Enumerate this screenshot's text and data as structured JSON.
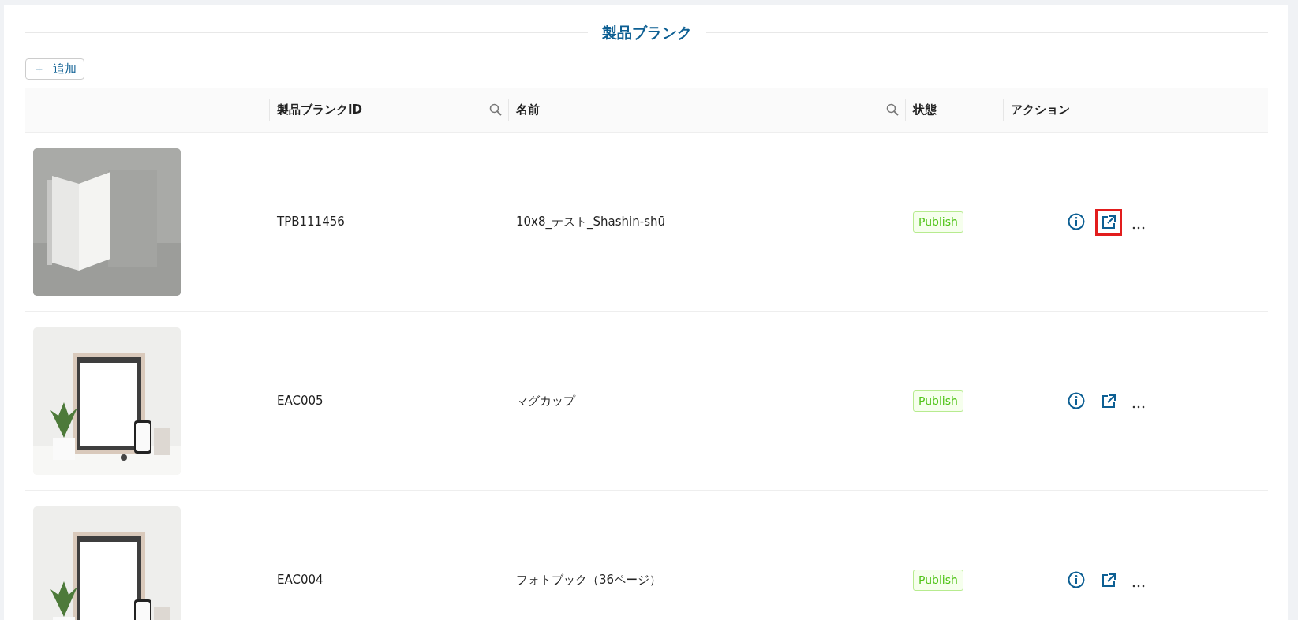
{
  "title": "製品ブランク",
  "add_button": {
    "icon": "＋",
    "label": "追加"
  },
  "table": {
    "columns": [
      {
        "searchable": false
      },
      {
        "label": "製品ブランクID",
        "searchable": true
      },
      {
        "label": "名前",
        "searchable": true
      },
      {
        "label": "状態",
        "searchable": false
      },
      {
        "label": "アクション",
        "searchable": false
      }
    ],
    "rows": [
      {
        "kind": "books",
        "id": "TPB111456",
        "name": "10x8_テスト_Shashin-shū",
        "status": "Publish",
        "actions": [
          {
            "kind": "info",
            "highlighted": false
          },
          {
            "kind": "open",
            "highlighted": true
          },
          {
            "kind": "more",
            "highlighted": false
          }
        ]
      },
      {
        "kind": "frame",
        "id": "EAC005",
        "name": "マグカップ",
        "status": "Publish",
        "actions": [
          {
            "kind": "info",
            "highlighted": false
          },
          {
            "kind": "open",
            "highlighted": false
          },
          {
            "kind": "more",
            "highlighted": false
          }
        ]
      },
      {
        "kind": "frame",
        "id": "EAC004",
        "name": "フォトブック（36ページ）",
        "status": "Publish",
        "actions": [
          {
            "kind": "info",
            "highlighted": false
          },
          {
            "kind": "open",
            "highlighted": false
          },
          {
            "kind": "more",
            "highlighted": false
          }
        ]
      }
    ]
  }
}
